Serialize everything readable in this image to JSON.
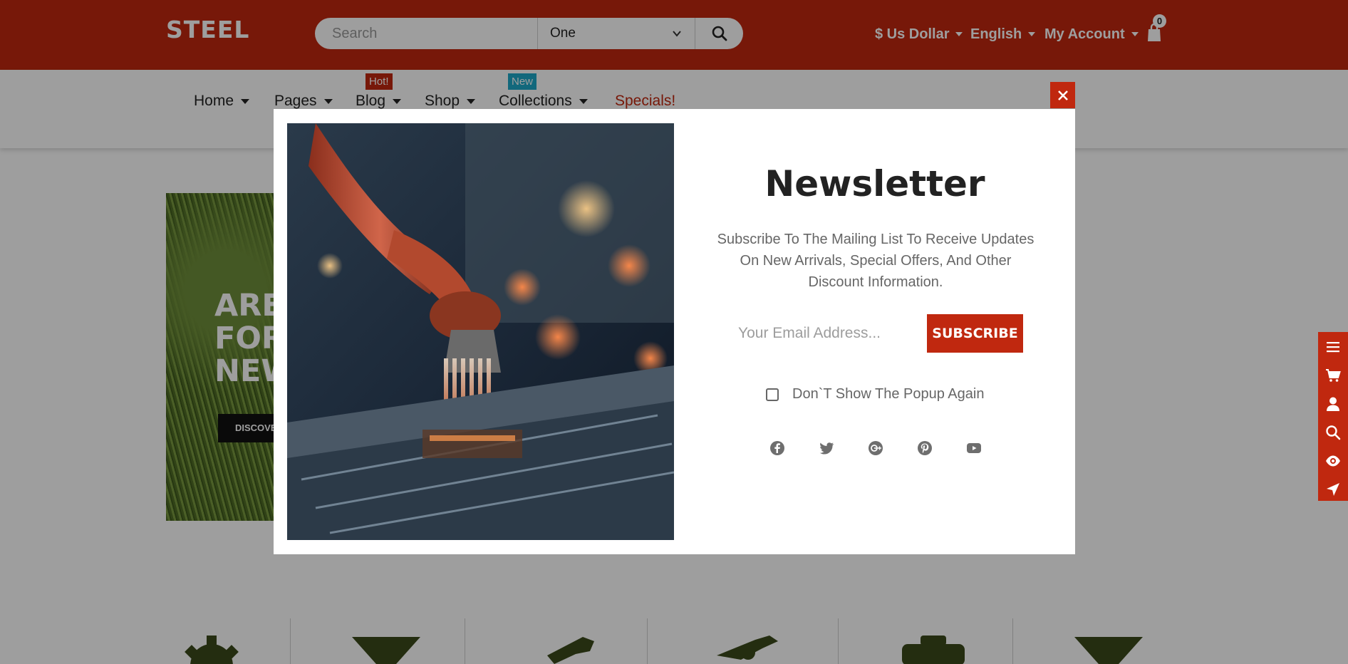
{
  "header": {
    "logo": "STEEL",
    "search": {
      "placeholder": "Search",
      "category": "One"
    },
    "currency": "$ Us Dollar",
    "language": "English",
    "account": "My Account",
    "cart_count": "0"
  },
  "nav": {
    "items": [
      {
        "label": "Home"
      },
      {
        "label": "Pages"
      },
      {
        "label": "Blog",
        "badge": "Hot!"
      },
      {
        "label": "Shop"
      },
      {
        "label": "Collections",
        "badge": "New"
      },
      {
        "label": "Specials!"
      }
    ]
  },
  "banner": {
    "text_line1": "ARE",
    "text_line2": "FOR",
    "text_line3": "NEW",
    "button": "DISCOVER"
  },
  "popup": {
    "title": "Newsletter",
    "description": "Subscribe To The Mailing List To Receive Updates On New Arrivals, Special Offers, And Other Discount Information.",
    "email_placeholder": "Your Email Address...",
    "subscribe_label": "SUBSCRIBE",
    "dont_show_label": "Don`T Show The Popup Again",
    "social": [
      "facebook-icon",
      "twitter-icon",
      "google-plus-icon",
      "pinterest-icon",
      "youtube-icon"
    ]
  },
  "sidebar": {
    "icons": [
      "menu-icon",
      "cart-icon",
      "user-icon",
      "search-icon",
      "eye-icon",
      "location-arrow-icon"
    ]
  },
  "colors": {
    "brand": "#c0280f",
    "new_badge": "#1ea9c9",
    "overlay": "rgba(0,0,0,0.38)"
  }
}
